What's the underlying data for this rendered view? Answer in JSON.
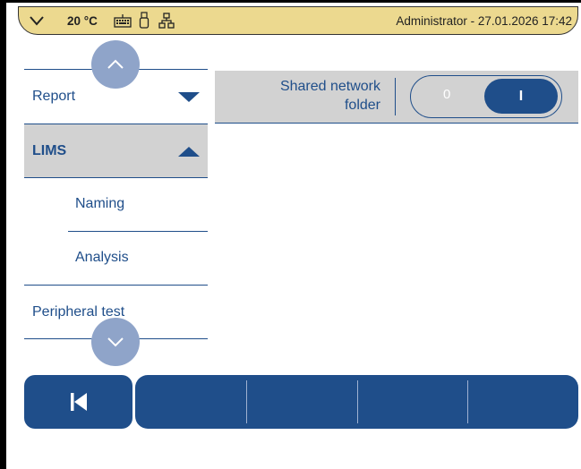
{
  "status_bar": {
    "temperature": "20 °C",
    "user_datetime": "Administrator - 27.01.2026 17:42",
    "icons": [
      "chevron-down-icon",
      "keyboard-icon",
      "usb-icon",
      "network-icon"
    ]
  },
  "sidebar": {
    "items": [
      {
        "label": "Report",
        "expanded": false
      },
      {
        "label": "LIMS",
        "expanded": true,
        "children": [
          "Naming",
          "Analysis"
        ]
      },
      {
        "label": "Peripheral test"
      }
    ]
  },
  "setting": {
    "label": "Shared network folder",
    "toggle": {
      "off_label": "0",
      "on_label": "I",
      "state": "on"
    }
  },
  "colors": {
    "accent": "#1f4e8a",
    "status_bar": "#ecd98f",
    "panel": "#d2d2d2",
    "scroll_button": "#8fa4c9"
  }
}
